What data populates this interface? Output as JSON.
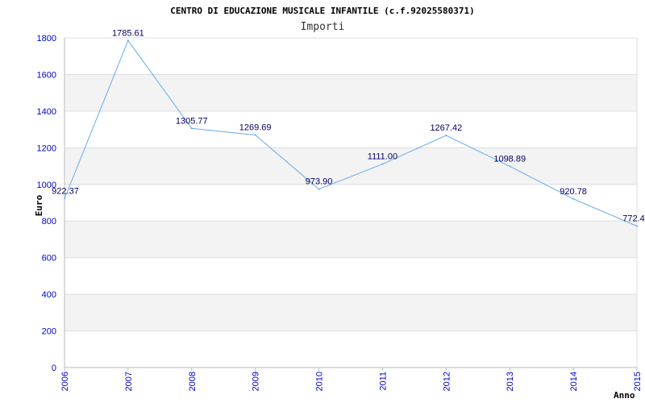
{
  "chart_data": {
    "type": "line",
    "title": "CENTRO DI EDUCAZIONE MUSICALE INFANTILE (c.f.92025580371)",
    "subtitle": "Importi",
    "xlabel": "Anno",
    "ylabel": "Euro",
    "categories": [
      "2006",
      "2007",
      "2008",
      "2009",
      "2010",
      "2011",
      "2012",
      "2013",
      "2014",
      "2015"
    ],
    "series": [
      {
        "values": [
          922.37,
          1785.61,
          1305.77,
          1269.69,
          973.9,
          1111.0,
          1267.42,
          1098.89,
          920.78,
          772.4
        ],
        "labels": [
          "922.37",
          "1785.61",
          "1305.77",
          "1269.69",
          "973.90",
          "1111.00",
          "1267.42",
          "1098.89",
          "920.78",
          "772.4"
        ]
      }
    ],
    "ylim": [
      0,
      1800
    ],
    "yticks": [
      "0",
      "200",
      "400",
      "600",
      "800",
      "1000",
      "1200",
      "1400",
      "1600",
      "1800"
    ],
    "grid": true,
    "colors": {
      "line": "#66aaee",
      "band": "#f3f3f3",
      "grid": "#dddddd",
      "tick_text": "#0000cc",
      "data_label": "#000066"
    }
  }
}
